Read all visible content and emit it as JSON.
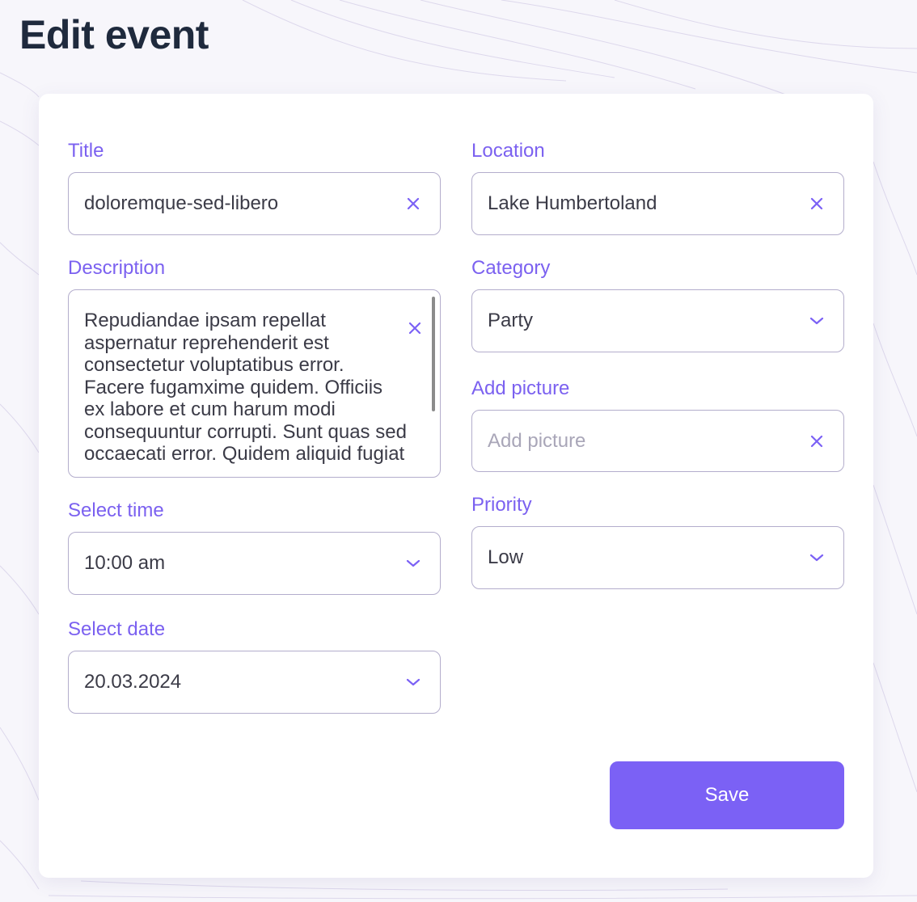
{
  "page": {
    "title": "Edit event"
  },
  "colors": {
    "accent": "#7b61f5",
    "label": "#7b61f0",
    "border": "#b3adcc",
    "title": "#1f2a3d"
  },
  "form": {
    "title": {
      "label": "Title",
      "value": "doloremque-sed-libero",
      "icon": "clear-icon"
    },
    "location": {
      "label": "Location",
      "value": "Lake Humbertoland",
      "icon": "clear-icon"
    },
    "description": {
      "label": "Description",
      "value": "Repudiandae ipsam repellat aspernatur reprehenderit est consectetur voluptatibus error. Facere fugamxime quidem. Officiis ex labore et cum harum modi consequuntur corrupti. Sunt quas sed occaecati error. Quidem aliquid fugiat",
      "icon": "clear-icon"
    },
    "category": {
      "label": "Category",
      "value": "Party",
      "icon": "chevron-down-icon"
    },
    "picture": {
      "label": "Add picture",
      "placeholder": "Add picture",
      "icon": "clear-icon"
    },
    "time": {
      "label": "Select time",
      "value": "10:00 am",
      "icon": "chevron-down-icon"
    },
    "priority": {
      "label": "Priority",
      "value": "Low",
      "icon": "chevron-down-icon"
    },
    "date": {
      "label": "Select date",
      "value": "20.03.2024",
      "icon": "chevron-down-icon"
    },
    "save_label": "Save"
  }
}
